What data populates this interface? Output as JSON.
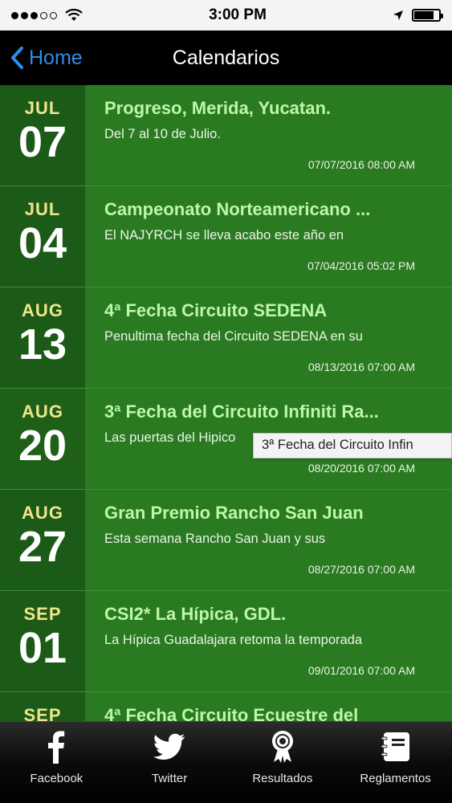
{
  "status_bar": {
    "time": "3:00 PM"
  },
  "nav": {
    "back_label": "Home",
    "title": "Calendarios"
  },
  "events": [
    {
      "month": "JUL",
      "day": "07",
      "title": "Progreso, Merida, Yucatan.",
      "description": "Del 7 al 10 de Julio.",
      "timestamp": "07/07/2016 08:00 AM"
    },
    {
      "month": "JUL",
      "day": "04",
      "title": "Campeonato Norteamericano ...",
      "description": "El NAJYRCH se lleva acabo este año en",
      "timestamp": "07/04/2016 05:02 PM"
    },
    {
      "month": "AUG",
      "day": "13",
      "title": "4ª Fecha Circuito SEDENA",
      "description": "Penultima fecha del Circuito SEDENA en su",
      "timestamp": "08/13/2016 07:00 AM"
    },
    {
      "month": "AUG",
      "day": "20",
      "title": "3ª Fecha del Circuito Infiniti Ra...",
      "description": "Las puertas del Hipico",
      "timestamp": "08/20/2016 07:00 AM"
    },
    {
      "month": "AUG",
      "day": "27",
      "title": "Gran Premio Rancho San Juan",
      "description": "Esta semana Rancho San Juan y sus",
      "timestamp": "08/27/2016 07:00 AM"
    },
    {
      "month": "SEP",
      "day": "01",
      "title": "CSI2* La Hípica, GDL.",
      "description": "La Hípica Guadalajara retoma la temporada",
      "timestamp": "09/01/2016 07:00 AM"
    },
    {
      "month": "SEP",
      "day": "",
      "title": "4ª Fecha Circuito Ecuestre del",
      "description": "",
      "timestamp": ""
    }
  ],
  "tooltip": "3ª Fecha del Circuito Infin",
  "tabs": [
    {
      "label": "Facebook",
      "icon": "facebook-icon"
    },
    {
      "label": "Twitter",
      "icon": "twitter-icon"
    },
    {
      "label": "Resultados",
      "icon": "award-ribbon-icon"
    },
    {
      "label": "Reglamentos",
      "icon": "notebook-icon"
    }
  ],
  "colors": {
    "row_background": "#2a7a22",
    "date_background": "#1c5a17",
    "month_text": "#f0e58a",
    "title_text": "#bdf7a7",
    "nav_back": "#2f8ce8"
  }
}
